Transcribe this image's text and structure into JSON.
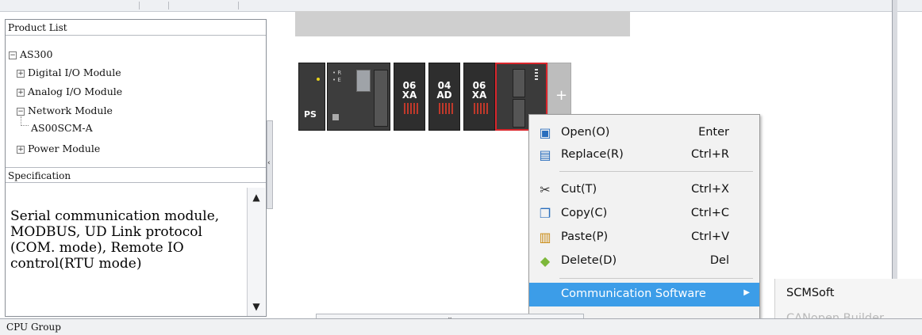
{
  "left_panel": {
    "product_list_title": "Product List",
    "tree": [
      {
        "toggle": "−",
        "label": "AS300"
      },
      {
        "toggle": "+",
        "label": "Digital I/O Module"
      },
      {
        "toggle": "+",
        "label": "Analog I/O Module"
      },
      {
        "toggle": "−",
        "label": "Network Module"
      },
      {
        "toggle": "",
        "label": "AS00SCM-A"
      },
      {
        "toggle": "+",
        "label": "Power Module"
      }
    ],
    "specification_title": "Specification",
    "specification_text": "Serial communication module, MODBUS, UD Link protocol (COM. mode), Remote IO control(RTU mode)"
  },
  "bottom": {
    "cpu_group_label": "CPU Group"
  },
  "rack": {
    "modules": [
      {
        "id": "power-supply",
        "label": "PS"
      },
      {
        "id": "cpu",
        "label": ""
      },
      {
        "id": "module-06xa-1",
        "code": [
          "06",
          "XA"
        ]
      },
      {
        "id": "module-04ad",
        "code": [
          "04",
          "AD"
        ]
      },
      {
        "id": "module-06xa-2",
        "code": [
          "06",
          "XA"
        ]
      },
      {
        "id": "module-scm-selected",
        "label": ""
      }
    ],
    "add_slot_label": "+",
    "selected_border_color": "#d9262c"
  },
  "context_menu": {
    "items": [
      {
        "label": "Open(O)",
        "shortcut": "Enter",
        "icon": "open-icon"
      },
      {
        "label": "Replace(R)",
        "shortcut": "Ctrl+R",
        "icon": "replace-icon"
      },
      {
        "label": "Cut(T)",
        "shortcut": "Ctrl+X",
        "icon": "scissors-icon"
      },
      {
        "label": "Copy(C)",
        "shortcut": "Ctrl+C",
        "icon": "copy-icon"
      },
      {
        "label": "Paste(P)",
        "shortcut": "Ctrl+V",
        "icon": "paste-icon"
      },
      {
        "label": "Delete(D)",
        "shortcut": "Del",
        "icon": "eraser-icon"
      }
    ],
    "submenu_trigger": "Communication Software",
    "highlight_color": "#3c9de8"
  },
  "submenu": {
    "items": [
      {
        "label": "SCMSoft",
        "enabled": true
      },
      {
        "label": "CANopen Builder",
        "enabled": false
      }
    ]
  }
}
